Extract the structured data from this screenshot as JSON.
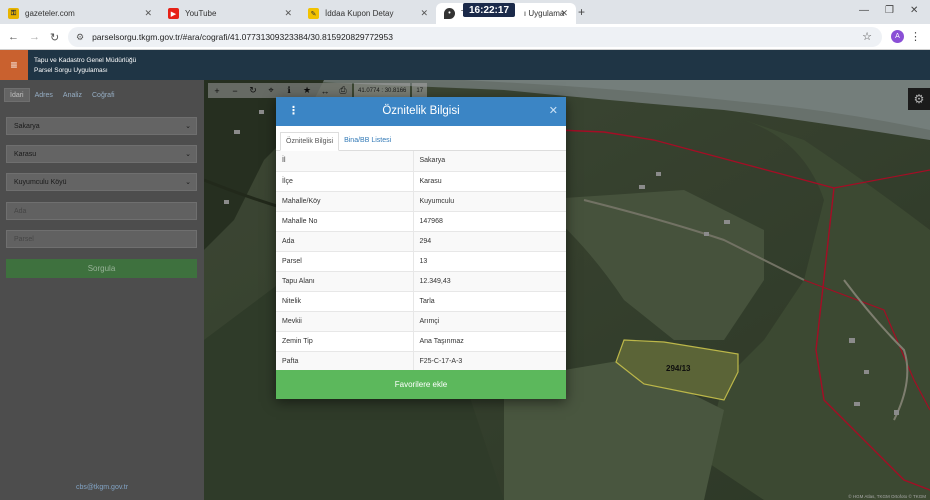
{
  "browser": {
    "tabs": [
      {
        "label": "gazeteler.com",
        "icon": "key-icon"
      },
      {
        "label": "YouTube",
        "icon": "youtube-icon"
      },
      {
        "label": "İddaa Kupon Detay",
        "icon": "ticket-icon"
      },
      {
        "label": "T",
        "suffix": "ı Uygulama",
        "icon": "location-pin-icon"
      }
    ],
    "clock": "16:22:17",
    "url": "parselsorgu.tkgm.gov.tr/#ara/cografi/41.07731309323384/30.815920829772953",
    "profile_initial": "A"
  },
  "app": {
    "org_name": "Tapu ve Kadastro Genel Müdürlüğü",
    "app_name": "Parsel Sorgu Uygulaması"
  },
  "sidebar": {
    "tabs": [
      "İdari",
      "Adres",
      "Analiz",
      "Coğrafi"
    ],
    "province": "Sakarya",
    "district": "Karasu",
    "village": "Kuyumculu Köyü",
    "block_placeholder": "Ada",
    "parcel_placeholder": "Parsel",
    "search_label": "Sorgula",
    "email": "cbs@tkgm.gov.tr"
  },
  "map": {
    "coords": "41.0774 : 30.8166",
    "zoom": "17",
    "parcel_label": "294/13",
    "attribution": "© HGM Atlas, TKGM Ortofoto © TKGM"
  },
  "modal": {
    "title": "Öznitelik Bilgisi",
    "tabs": [
      "Öznitelik Bilgisi",
      "Bina/BB Listesi"
    ],
    "rows": [
      {
        "key": "İl",
        "value": "Sakarya"
      },
      {
        "key": "İlçe",
        "value": "Karasu"
      },
      {
        "key": "Mahalle/Köy",
        "value": "Kuyumculu"
      },
      {
        "key": "Mahalle No",
        "value": "147968"
      },
      {
        "key": "Ada",
        "value": "294"
      },
      {
        "key": "Parsel",
        "value": "13"
      },
      {
        "key": "Tapu Alanı",
        "value": "12.349,43"
      },
      {
        "key": "Nitelik",
        "value": "Tarla"
      },
      {
        "key": "Mevkii",
        "value": "Arımçi"
      },
      {
        "key": "Zemin Tip",
        "value": "Ana Taşınmaz"
      },
      {
        "key": "Pafta",
        "value": "F25-C-17-A-3"
      }
    ],
    "favorite_label": "Favorilere ekle"
  }
}
